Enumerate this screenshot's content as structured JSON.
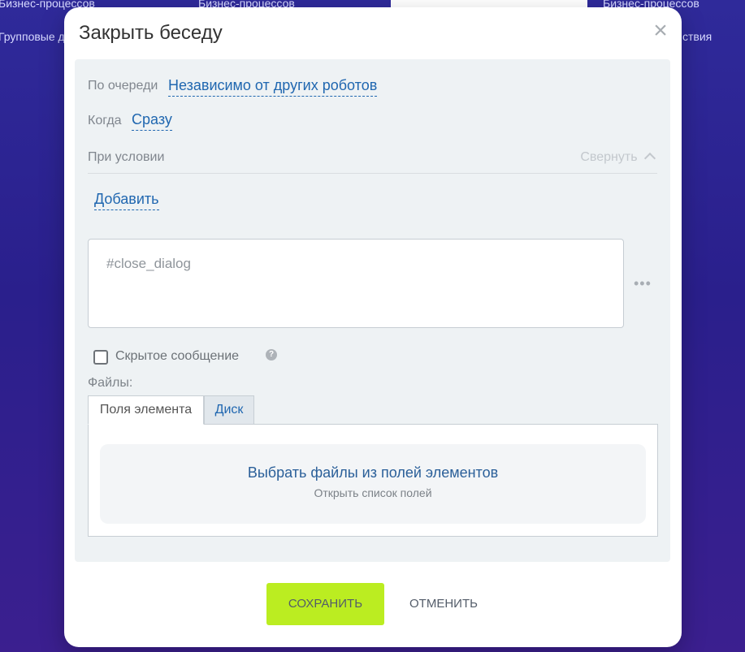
{
  "background": {
    "text_top_left": "Бизнес-процессов",
    "text_top_mid": "Бизнес-процессов",
    "text_top_right": "Бизнес-процессов",
    "text_second_left": "Групповые д",
    "text_second_right": "ствия"
  },
  "modal": {
    "title": "Закрыть беседу",
    "close_icon": "×"
  },
  "settings": {
    "queue_label": "По очереди",
    "queue_value": "Независимо от других роботов",
    "when_label": "Когда",
    "when_value": "Сразу",
    "condition_label": "При условии",
    "collapse_label": "Свернуть",
    "collapse_icon": "^",
    "add_condition": "Добавить"
  },
  "message": {
    "value": "#close_dialog",
    "more_icon": "•••"
  },
  "hidden_message": {
    "label": "Скрытое сообщение",
    "checked": false,
    "help_icon": "?"
  },
  "files": {
    "label": "Файлы:",
    "tabs": [
      {
        "label": "Поля элемента",
        "active": true
      },
      {
        "label": "Диск",
        "active": false
      }
    ],
    "select_title": "Выбрать файлы из полей элементов",
    "select_subtitle": "Открыть список полей"
  },
  "actions": {
    "save": "СОХРАНИТЬ",
    "cancel": "ОТМЕНИТЬ"
  },
  "colors": {
    "save_bg": "#bbed21",
    "link": "#2067b0",
    "panel_bg": "#eef2f4"
  }
}
